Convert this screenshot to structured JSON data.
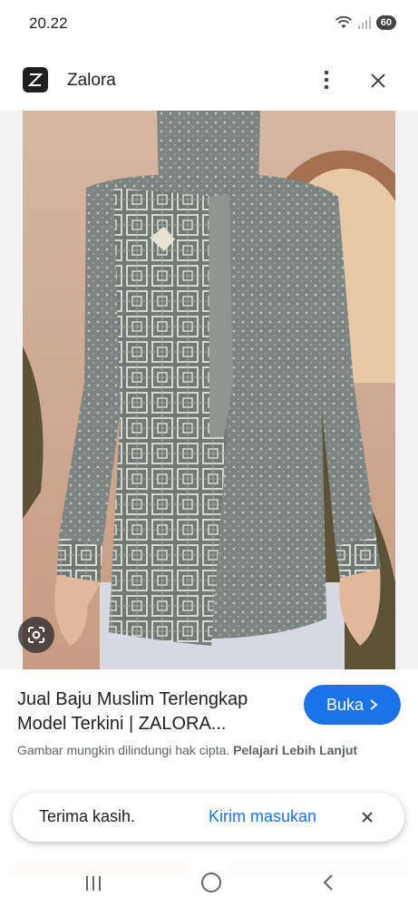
{
  "status": {
    "time": "20.22",
    "battery": "60"
  },
  "app": {
    "title": "Zalora",
    "logo_letter": "Z"
  },
  "result": {
    "title_line1": "Jual Baju Muslim Terlengkap",
    "title_line2": "Model Terkini | ZALORA...",
    "open_label": "Buka",
    "copyright_text": "Gambar mungkin dilindungi hak cipta.",
    "learn_more": "Pelajari Lebih Lanjut"
  },
  "feedback": {
    "thanks": "Terima kasih.",
    "send": "Kirim masukan"
  },
  "colors": {
    "accent": "#1a73e8",
    "text": "#202124",
    "muted": "#5f6368"
  }
}
